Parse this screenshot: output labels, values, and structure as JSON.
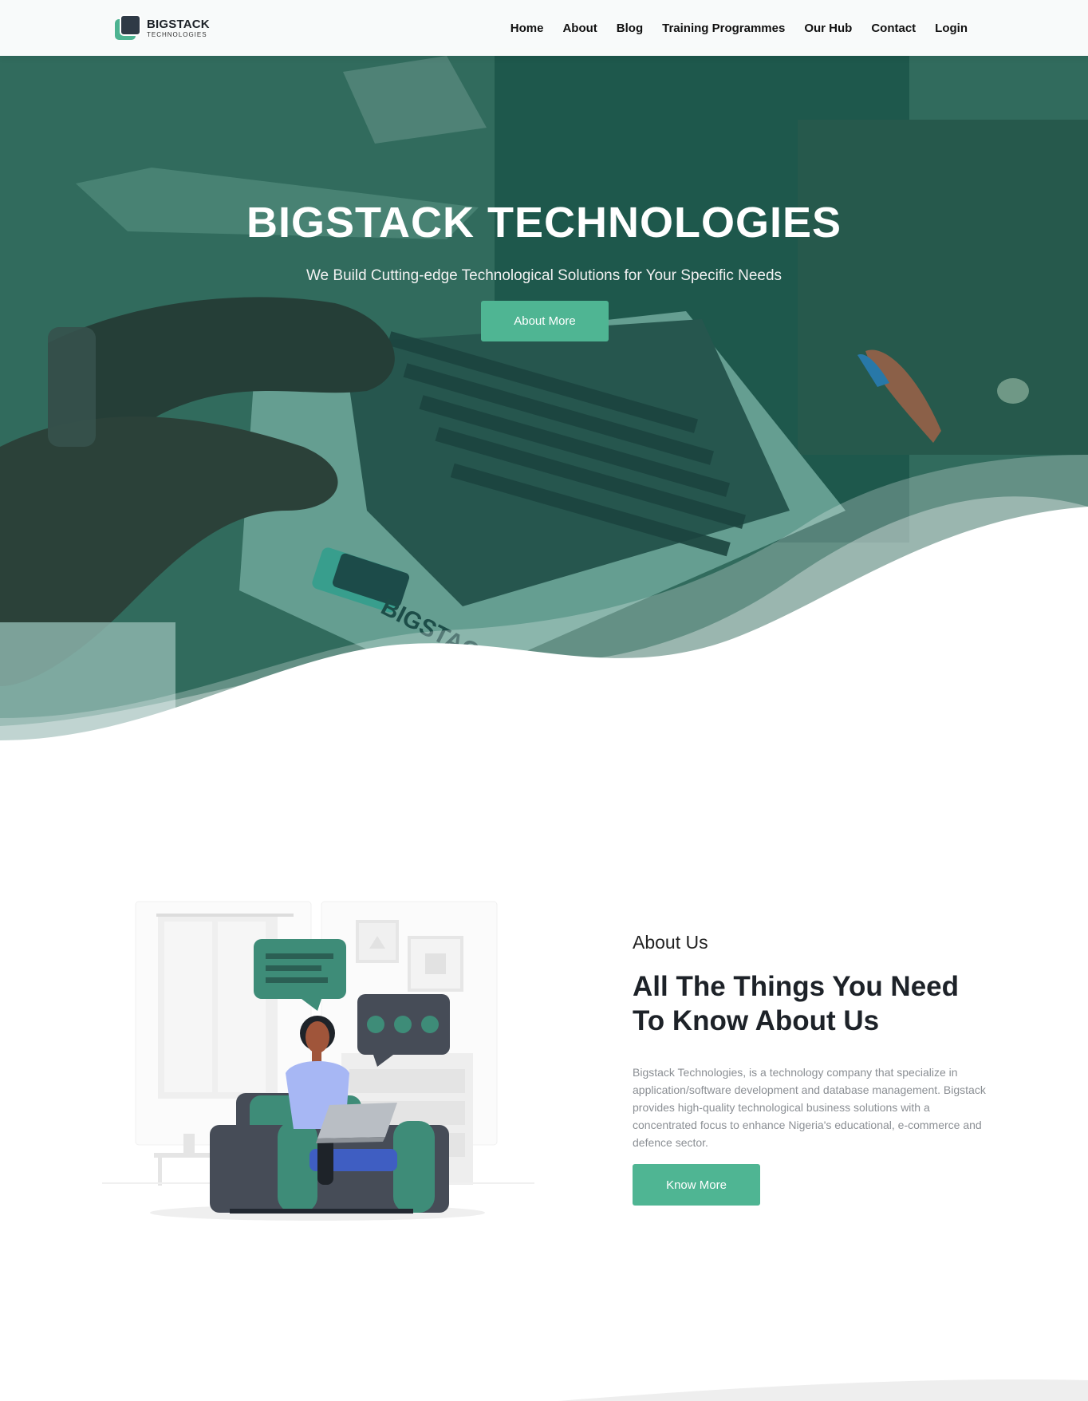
{
  "brand": {
    "name": "BIGSTACK",
    "tagline": "TECHNOLOGIES"
  },
  "nav": {
    "items": [
      {
        "label": "Home"
      },
      {
        "label": "About"
      },
      {
        "label": "Blog"
      },
      {
        "label": "Training Programmes"
      },
      {
        "label": "Our Hub"
      },
      {
        "label": "Contact"
      },
      {
        "label": "Login"
      }
    ]
  },
  "hero": {
    "title": "BIGSTACK TECHNOLOGIES",
    "subtitle": "We Build Cutting-edge Technological Solutions for Your Specific Needs",
    "button_label": "About More"
  },
  "about": {
    "kicker": "About Us",
    "title": "All The Things You Need To Know About Us",
    "body": "Bigstack Technologies, is a technology company that specialize in application/software development and database management. Bigstack provides high-quality technological business solutions with a concentrated focus to enhance Nigeria's educational, e-commerce and defence sector.",
    "button_label": "Know More"
  },
  "colors": {
    "accent": "#4fb593",
    "dark": "#1d2228",
    "overlay": "#1e6e5f"
  }
}
